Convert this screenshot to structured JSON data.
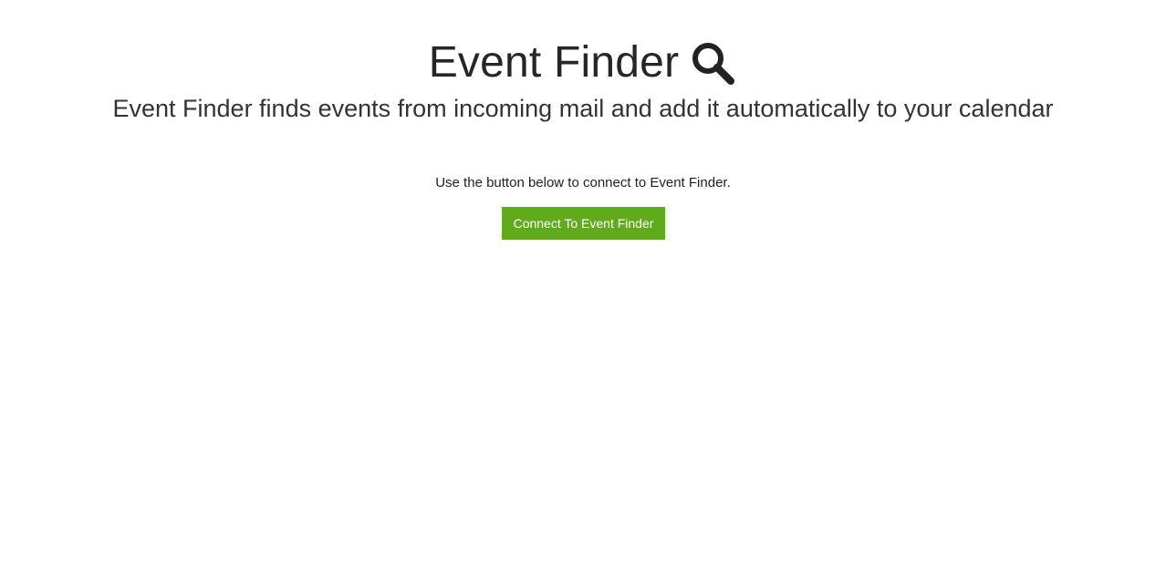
{
  "header": {
    "title": "Event Finder",
    "subtitle": "Event Finder finds events from incoming mail and add it automatically to your calendar",
    "icon": "search-icon"
  },
  "main": {
    "instructions": "Use the button below to connect to Event Finder.",
    "connect_button_label": "Connect To Event Finder"
  },
  "colors": {
    "button_bg": "#60ab1a",
    "button_text": "#ffffff",
    "title_text": "#262626"
  }
}
